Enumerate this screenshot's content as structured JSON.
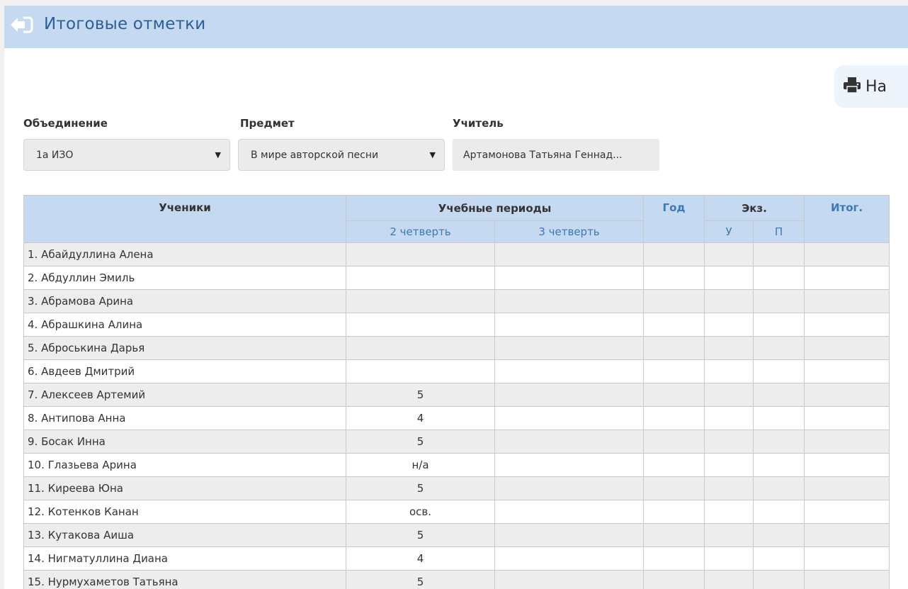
{
  "header": {
    "title": "Итоговые отметки",
    "back_icon": "back-arrow-icon"
  },
  "print": {
    "label": "На",
    "icon": "printer-icon"
  },
  "filters": {
    "group_label": "Объединение",
    "group_value": "1а ИЗО",
    "subject_label": "Предмет",
    "subject_value": "В мире авторской песни",
    "teacher_label": "Учитель",
    "teacher_value": "Артамонова Татьяна Геннад..."
  },
  "table": {
    "headers": {
      "students": "Ученики",
      "periods": "Учебные периоды",
      "q2": "2 четверть",
      "q3": "3 четверть",
      "year": "Год",
      "exam": "Экз.",
      "exam_u": "У",
      "exam_p": "П",
      "final": "Итог."
    },
    "rows": [
      {
        "name": "1. Абайдуллина Алена",
        "q2": ""
      },
      {
        "name": "2. Абдуллин Эмиль",
        "q2": ""
      },
      {
        "name": "3. Абрамова Арина",
        "q2": ""
      },
      {
        "name": "4. Абрашкина Алина",
        "q2": ""
      },
      {
        "name": "5. Аброськина Дарья",
        "q2": ""
      },
      {
        "name": "6. Авдеев Дмитрий",
        "q2": ""
      },
      {
        "name": "7. Алексеев Артемий",
        "q2": "5"
      },
      {
        "name": "8. Антипова Анна",
        "q2": "4"
      },
      {
        "name": "9. Босак Инна",
        "q2": "5"
      },
      {
        "name": "10. Глазьева Арина",
        "q2": "н/а"
      },
      {
        "name": "11. Киреева Юна",
        "q2": "5"
      },
      {
        "name": "12. Котенков Канан",
        "q2": "осв."
      },
      {
        "name": "13. Кутакова Аиша",
        "q2": "5"
      },
      {
        "name": "14. Нигматуллина Диана",
        "q2": "4"
      },
      {
        "name": "15. Нурмухаметов Татьяна",
        "q2": "5"
      }
    ]
  },
  "colors": {
    "header_bg": "#c5daf1",
    "title": "#2d5f94",
    "link_blue": "#3b78b8"
  }
}
